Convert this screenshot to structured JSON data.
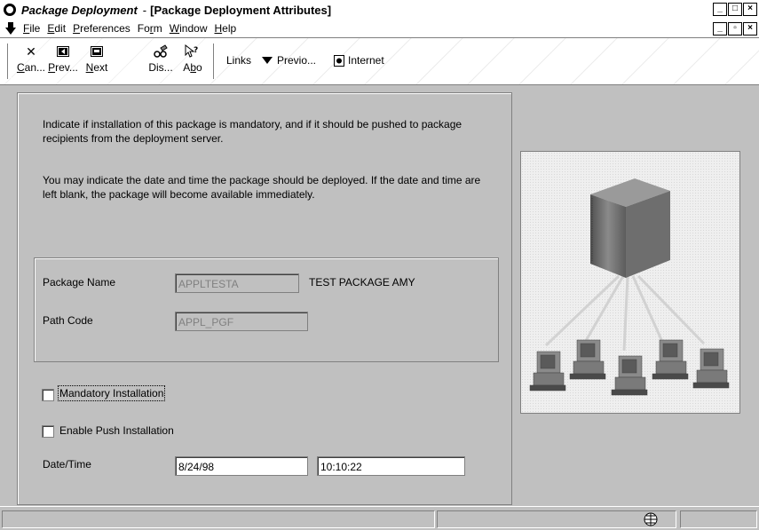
{
  "window": {
    "app_title": "Package Deployment",
    "separator": "-",
    "doc_title": "[Package Deployment Attributes]",
    "controls": [
      "_",
      "□",
      "×"
    ]
  },
  "menu": {
    "items": [
      {
        "accel": "F",
        "rest": "ile"
      },
      {
        "accel": "E",
        "rest": "dit"
      },
      {
        "accel": "P",
        "rest": "references"
      },
      {
        "pre": "Fo",
        "accel": "r",
        "rest": "m"
      },
      {
        "accel": "W",
        "rest": "indow"
      },
      {
        "accel": "H",
        "rest": "elp"
      }
    ],
    "mdi_controls": [
      "_",
      "▫",
      "×"
    ]
  },
  "toolbar": {
    "buttons": [
      {
        "accel": "C",
        "rest": "an...",
        "icon": "close-icon"
      },
      {
        "accel": "P",
        "rest": "rev...",
        "icon": "previous-icon"
      },
      {
        "accel": "N",
        "rest": "ext",
        "icon": "next-icon"
      },
      {
        "pre": "Dis",
        "accel": "",
        "rest": "...",
        "icon": "display-icon"
      },
      {
        "pre": "A",
        "accel": "b",
        "rest": "o",
        "icon": "about-icon"
      }
    ],
    "links_label": "Links",
    "previous_label": "Previo...",
    "internet_label": "Internet"
  },
  "form": {
    "instructions_1": "Indicate if installation of this package is mandatory, and if it should be pushed to package recipients from the deployment server.",
    "instructions_2": "You may indicate the date and time the package should be deployed.  If the date and time are left blank, the package will become available immediately.",
    "package_name_label": "Package Name",
    "package_name_value": "APPLTESTA",
    "package_description": "TEST PACKAGE AMY",
    "path_code_label": "Path Code",
    "path_code_value": "APPL_PGF",
    "mandatory_label": "Mandatory Installation",
    "mandatory_checked": false,
    "push_label": "Enable Push Installation",
    "push_checked": false,
    "datetime_label": "Date/Time",
    "date_value": "8/24/98",
    "time_value": "10:10:22"
  },
  "illustration": {
    "server_color": "#6a6a6a",
    "client_count": 5
  }
}
